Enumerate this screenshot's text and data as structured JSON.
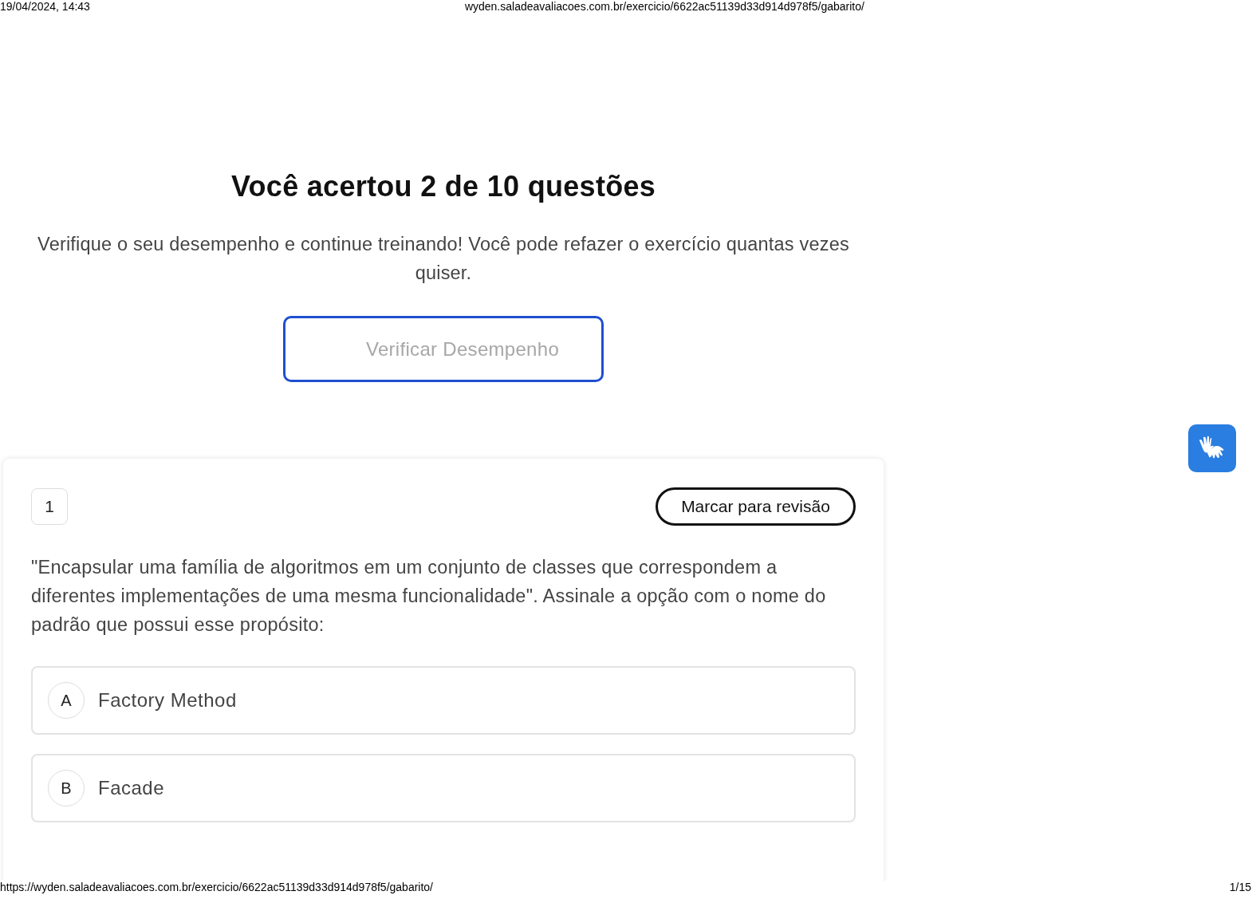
{
  "print_header": {
    "date": "19/04/2024, 14:43",
    "url": "wyden.saladeavaliacoes.com.br/exercicio/6622ac51139d33d914d978f5/gabarito/"
  },
  "result": {
    "title": "Você acertou 2 de 10 questões",
    "subtitle": "Verifique o seu desempenho e continue treinando! Você pode refazer o exercício quantas vezes quiser.",
    "button": "Verificar Desempenho"
  },
  "question": {
    "number": "1",
    "review_button": "Marcar para revisão",
    "text": "\"Encapsular uma família de algoritmos em um conjunto de classes que correspondem a diferentes implementações de uma mesma funcionalidade\". Assinale a opção com o nome do padrão que possui esse propósito:",
    "options": [
      {
        "letter": "A",
        "text": "Factory Method"
      },
      {
        "letter": "B",
        "text": "Facade"
      }
    ]
  },
  "print_footer": {
    "url": "https://wyden.saladeavaliacoes.com.br/exercicio/6622ac51139d33d914d978f5/gabarito/",
    "page": "1/15"
  }
}
